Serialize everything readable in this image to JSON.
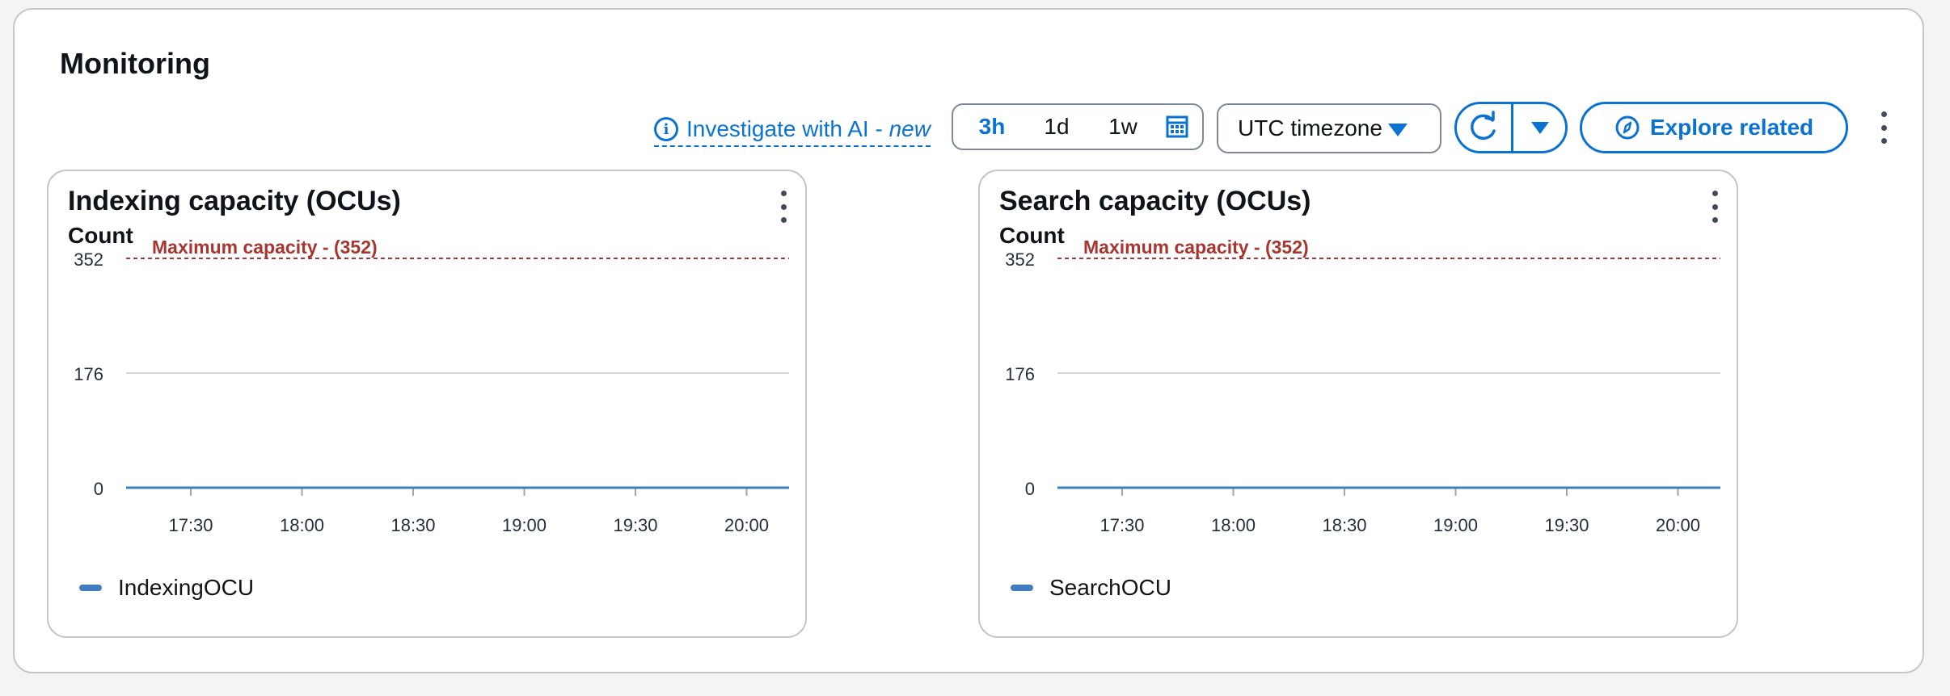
{
  "section": {
    "title": "Monitoring"
  },
  "toolbar": {
    "investigate": {
      "label": "Investigate with AI - ",
      "badge": "new",
      "icon": "info-icon"
    },
    "range": {
      "options": [
        "3h",
        "1d",
        "1w"
      ],
      "selected": "3h",
      "calendar_icon": "calendar-icon"
    },
    "timezone": {
      "label": "UTC timezone"
    },
    "refresh": {
      "icon": "refresh-icon",
      "dropdown_icon": "caret-down-icon"
    },
    "explore": {
      "label": "Explore related",
      "icon": "compass-icon"
    }
  },
  "colors": {
    "accent": "#0972d3",
    "threshold": "#a73530",
    "series": "#3f7fbf",
    "grid": "#d6d6d9"
  },
  "charts": [
    {
      "title": "Indexing capacity (OCUs)",
      "unit_label": "Count",
      "threshold_label": "Maximum capacity - (352)",
      "legend": "IndexingOCU"
    },
    {
      "title": "Search capacity (OCUs)",
      "unit_label": "Count",
      "threshold_label": "Maximum capacity - (352)",
      "legend": "SearchOCU"
    }
  ],
  "chart_data": [
    {
      "type": "line",
      "title": "Indexing capacity (OCUs)",
      "ylabel": "Count",
      "ylim": [
        0,
        352
      ],
      "yticks": [
        "352",
        "176",
        "0"
      ],
      "xticks": [
        "17:30",
        "18:00",
        "18:30",
        "19:00",
        "19:30",
        "20:00"
      ],
      "threshold": {
        "value": 352,
        "label": "Maximum capacity - (352)",
        "style": "dashed"
      },
      "series": [
        {
          "name": "IndexingOCU",
          "values": [
            0,
            0,
            0,
            0,
            0,
            0
          ]
        }
      ],
      "grid": true,
      "legend_position": "bottom-left"
    },
    {
      "type": "line",
      "title": "Search capacity (OCUs)",
      "ylabel": "Count",
      "ylim": [
        0,
        352
      ],
      "yticks": [
        "352",
        "176",
        "0"
      ],
      "xticks": [
        "17:30",
        "18:00",
        "18:30",
        "19:00",
        "19:30",
        "20:00"
      ],
      "threshold": {
        "value": 352,
        "label": "Maximum capacity - (352)",
        "style": "dashed"
      },
      "series": [
        {
          "name": "SearchOCU",
          "values": [
            0,
            0,
            0,
            0,
            0,
            0
          ]
        }
      ],
      "grid": true,
      "legend_position": "bottom-left"
    }
  ]
}
